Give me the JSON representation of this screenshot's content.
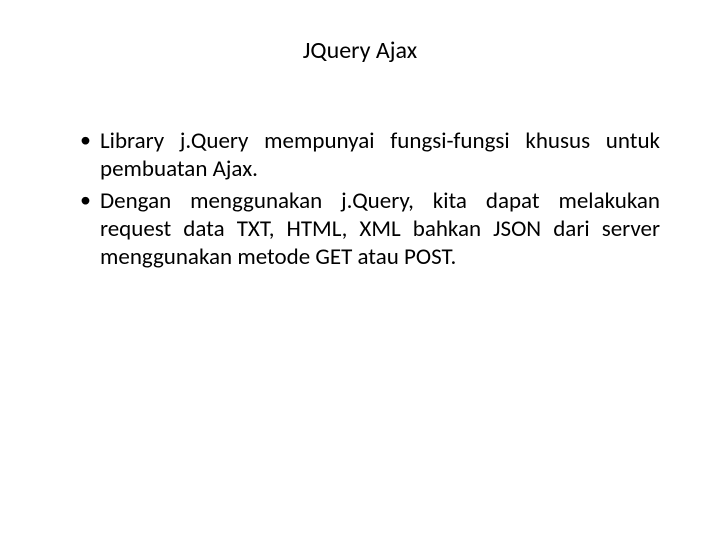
{
  "title": "JQuery Ajax",
  "bullets": [
    "Library j.Query mempunyai fungsi-fungsi khusus untuk pembuatan Ajax.",
    "Dengan menggunakan j.Query, kita dapat melakukan request data TXT, HTML, XML bahkan JSON dari server menggunakan metode GET atau POST."
  ]
}
